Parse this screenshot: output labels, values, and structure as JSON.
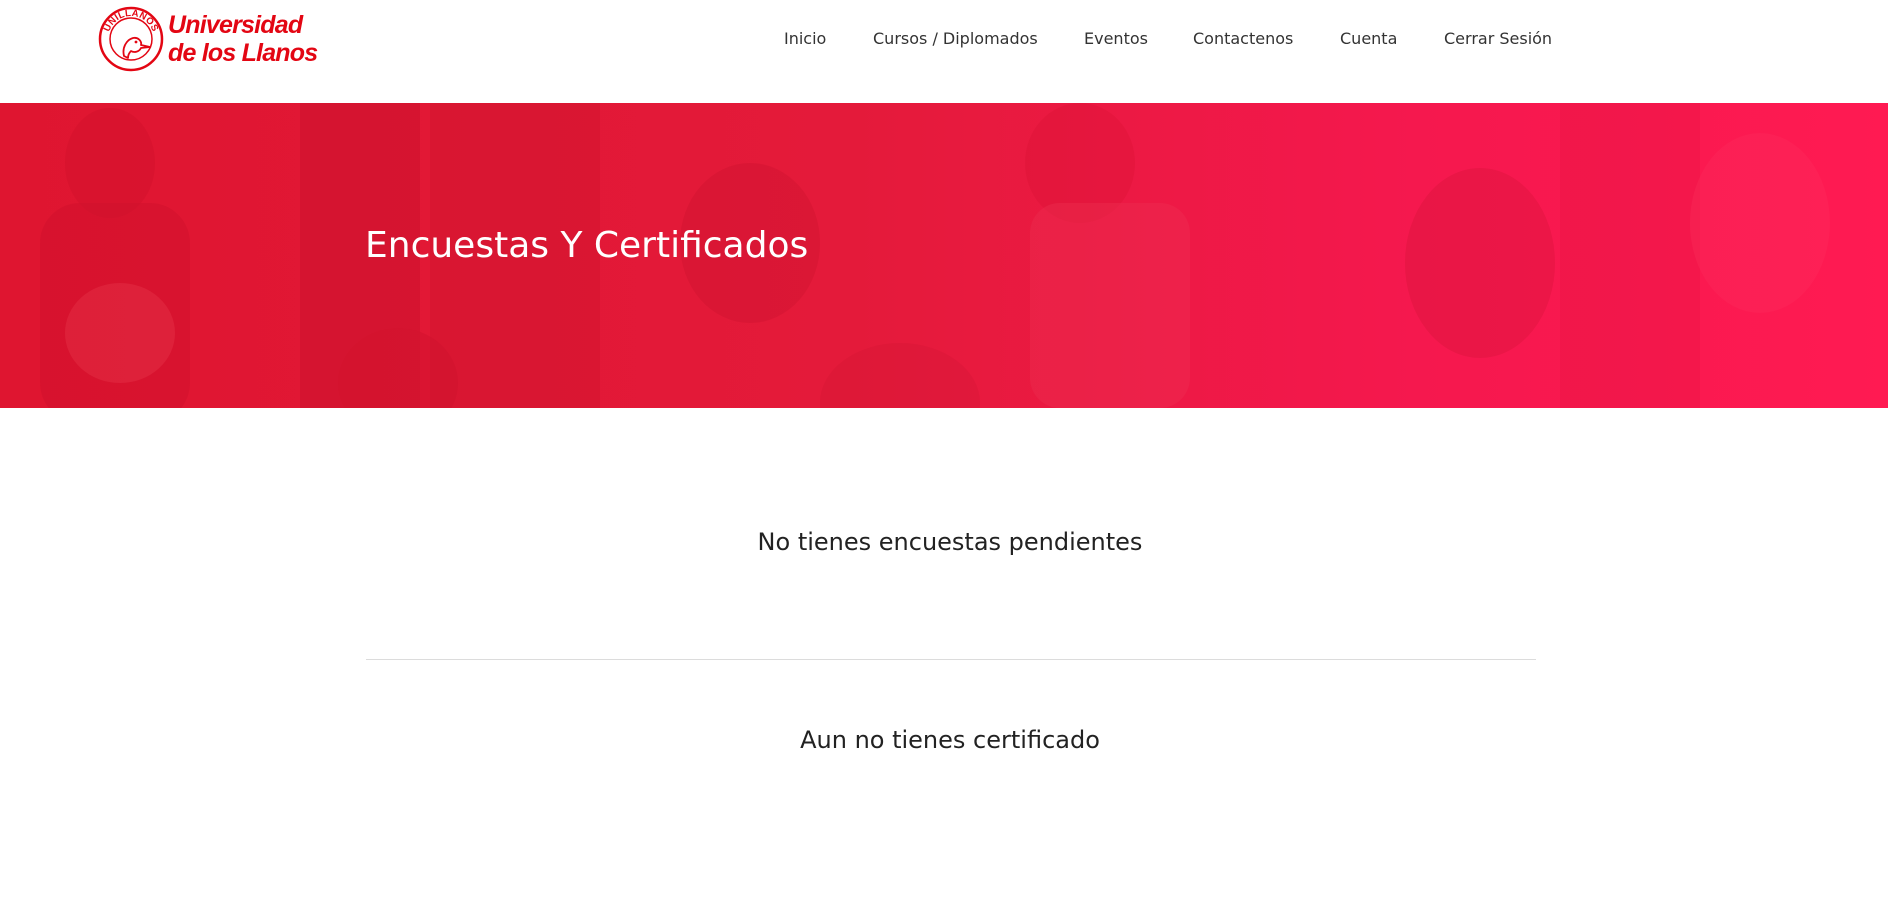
{
  "brand": {
    "name_line1": "Universidad",
    "name_line2": "de los Llanos",
    "emblem_text": "UNILLANOS",
    "color": "#e30613"
  },
  "nav": {
    "items": [
      {
        "label": "Inicio"
      },
      {
        "label": "Cursos / Diplomados"
      },
      {
        "label": "Eventos"
      },
      {
        "label": "Contactenos"
      },
      {
        "label": "Cuenta"
      },
      {
        "label": "Cerrar Sesión"
      }
    ]
  },
  "hero": {
    "title": "Encuestas Y Certificados",
    "overlay_color": "#e8173a"
  },
  "main": {
    "surveys_message": "No tienes encuestas pendientes",
    "certificates_message": "Aun no tienes certificado"
  }
}
